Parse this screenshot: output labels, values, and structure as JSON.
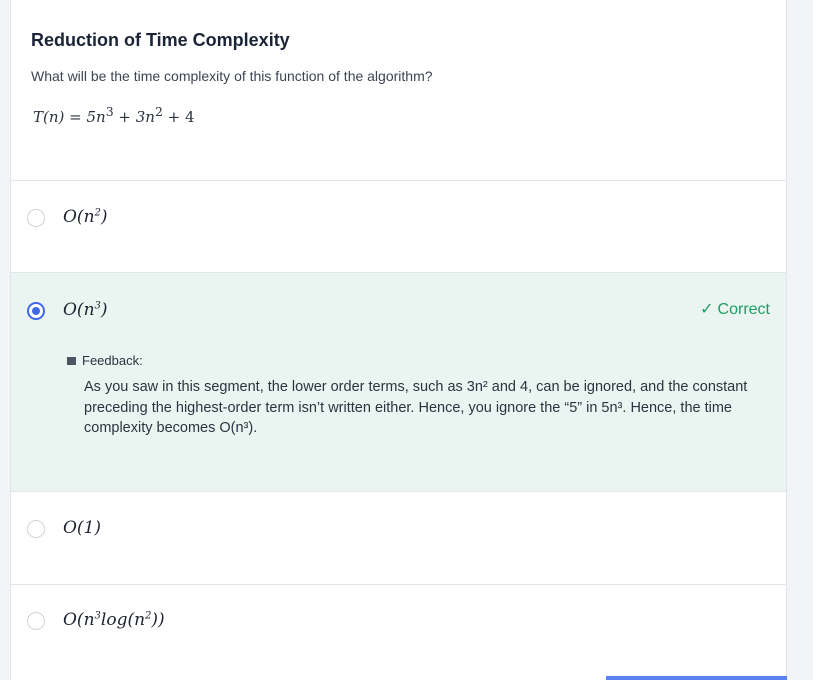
{
  "question": {
    "title": "Reduction of Time Complexity",
    "prompt": "What will be the time complexity of this function of the algorithm?",
    "formula": {
      "lhs": "T(n) = 5n",
      "exp1": "3",
      "mid": " + 3n",
      "exp2": "2",
      "rhs": " + 4"
    }
  },
  "options": [
    {
      "base": "O(n",
      "exp": "2",
      "tail": ")",
      "selected": false
    },
    {
      "base": "O(n",
      "exp": "3",
      "tail": ")",
      "selected": true
    },
    {
      "base": "O(1)",
      "exp": "",
      "tail": "",
      "selected": false
    },
    {
      "base": "O(n",
      "exp": "3",
      "tail": "log(n",
      "exp2": "2",
      "tail2": "))",
      "selected": false
    }
  ],
  "result": {
    "status_label": "Correct",
    "check_icon": "check-icon",
    "color": "#1f9d63"
  },
  "feedback": {
    "heading": "Feedback:",
    "body": "As you saw in this segment, the lower order terms, such as 3n² and 4, can be ignored, and the constant preceding the highest-order term isn’t written either. Hence, you ignore the “5” in 5n³. Hence, the time complexity becomes O(n³)."
  },
  "colors": {
    "accent": "#3f67e6",
    "selected_bg": "#eaf4f1",
    "correct": "#1f9d63"
  }
}
